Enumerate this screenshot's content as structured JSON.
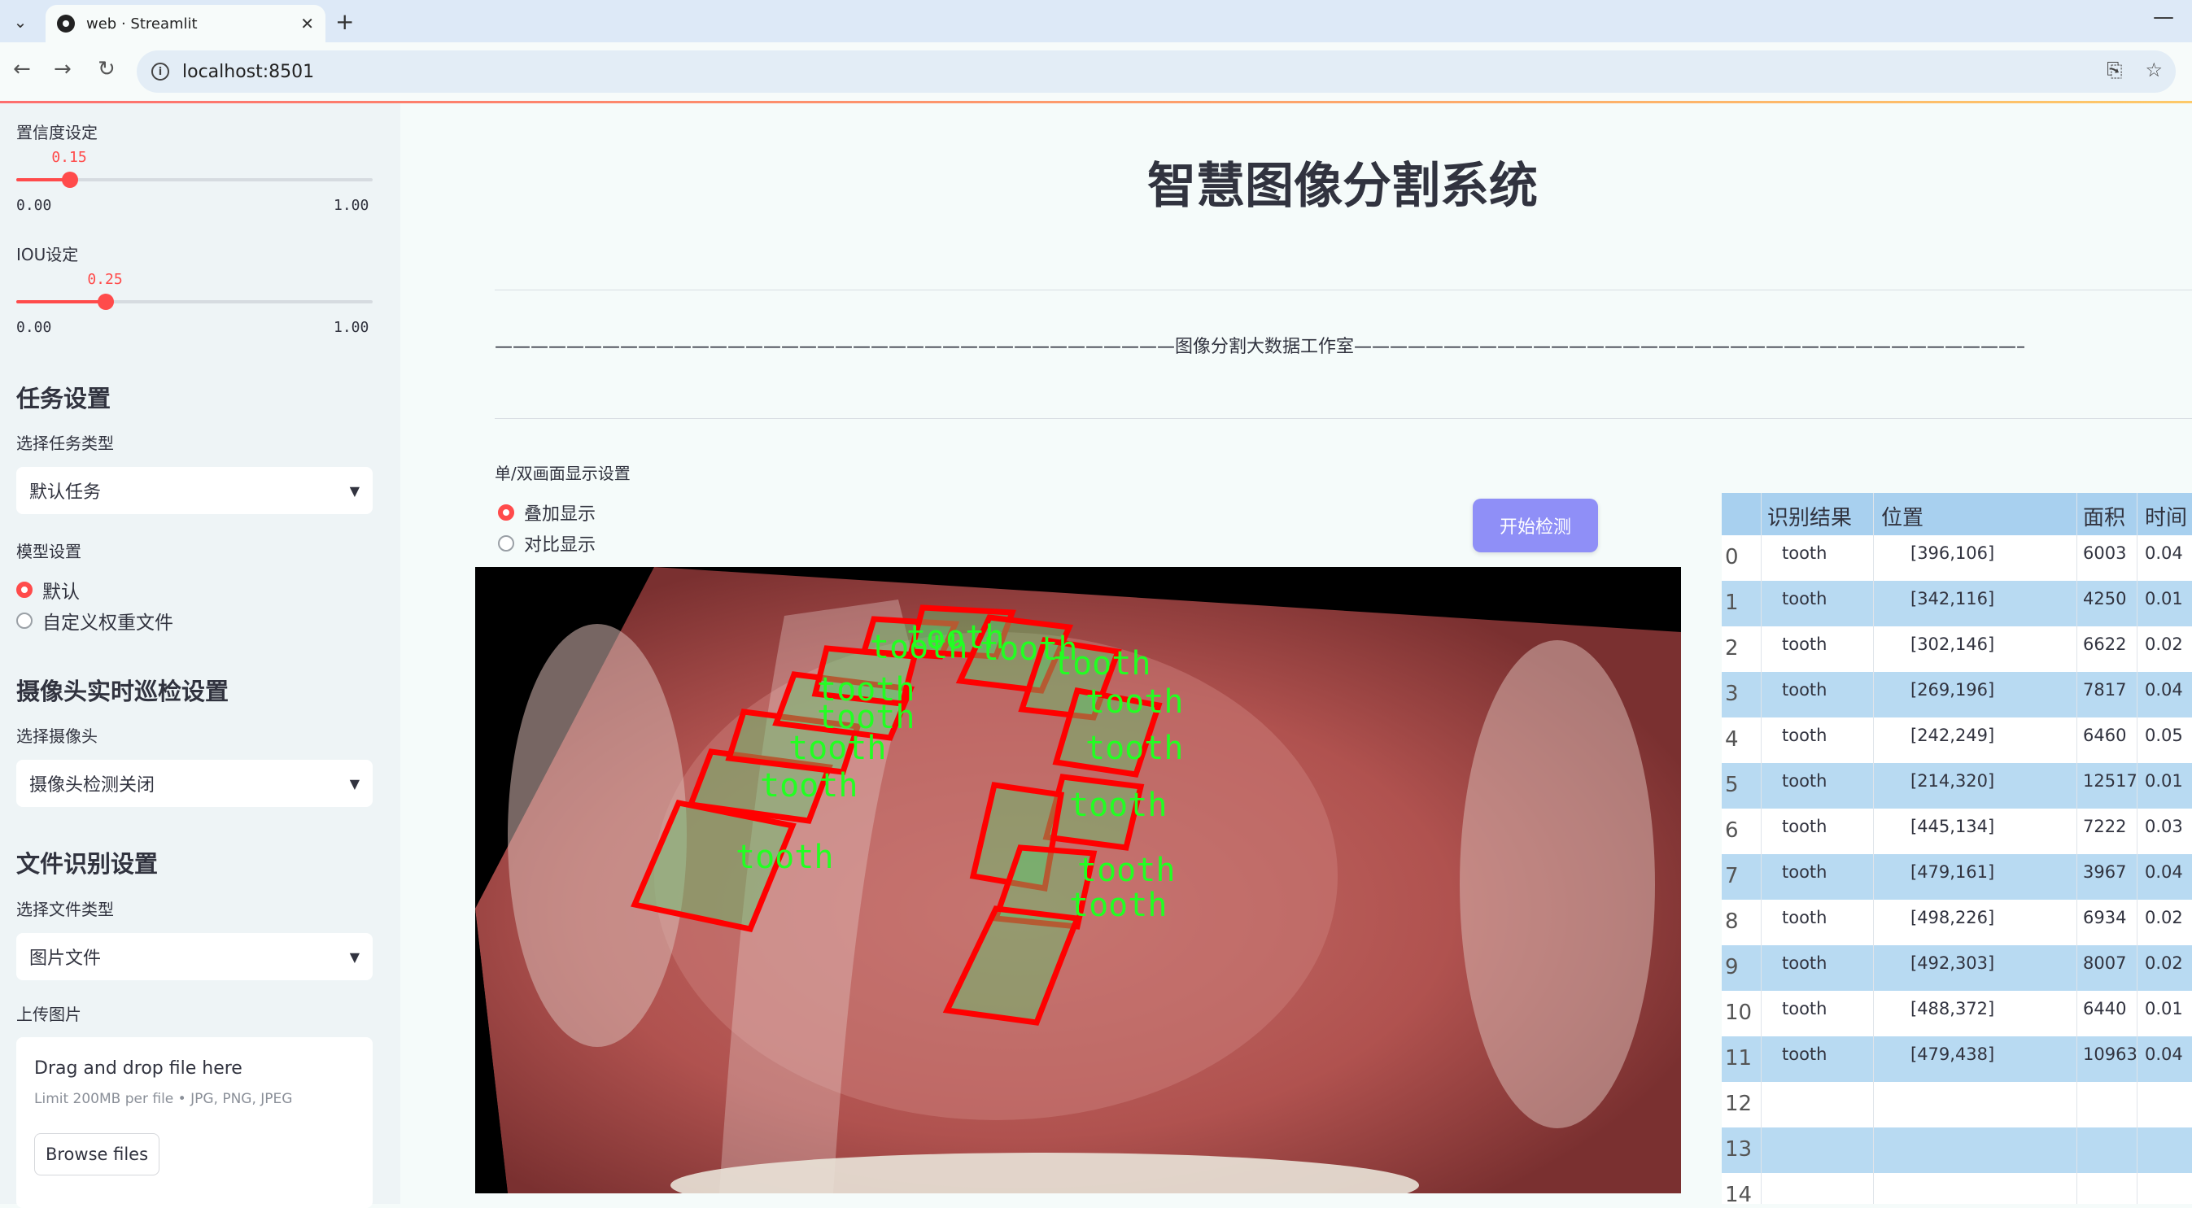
{
  "browser": {
    "tab_title": "web · Streamlit",
    "url": "localhost:8501"
  },
  "sidebar": {
    "confidence": {
      "label": "置信度设定",
      "value": "0.15",
      "value_num": 0.15,
      "min": "0.00",
      "max": "1.00"
    },
    "iou": {
      "label": "IOU设定",
      "value": "0.25",
      "value_num": 0.25,
      "min": "0.00",
      "max": "1.00"
    },
    "task_heading": "任务设置",
    "task_type_label": "选择任务类型",
    "task_type_value": "默认任务",
    "model_label": "模型设置",
    "model_options": [
      "默认",
      "自定义权重文件"
    ],
    "camera_heading": "摄像头实时巡检设置",
    "camera_label": "选择摄像头",
    "camera_value": "摄像头检测关闭",
    "file_heading": "文件识别设置",
    "file_type_label": "选择文件类型",
    "file_type_value": "图片文件",
    "upload_label": "上传图片",
    "upload_title": "Drag and drop file here",
    "upload_sub": "Limit 200MB per file • JPG, PNG, JPEG",
    "browse_label": "Browse files"
  },
  "main": {
    "title": "智慧图像分割系统",
    "studio_line": "——————————————————————————————————————图像分割大数据工作室——————————————————————————————————————————",
    "display_label": "单/双画面显示设置",
    "display_options": [
      "叠加显示",
      "对比显示"
    ],
    "start_button": "开始检测",
    "overlay_label": "tooth"
  },
  "colors": {
    "accent": "#ff4b4b",
    "button": "#8f8ff7",
    "table_header": "#a8d0ef",
    "table_alt": "#b8daf2",
    "box": "#ff0000",
    "label": "#22ff22"
  },
  "table": {
    "headers": [
      "",
      "识别结果",
      "位置",
      "面积",
      "时间"
    ],
    "rows": [
      {
        "idx": "0",
        "result": "tooth",
        "pos": "[396,106]",
        "area": "6003",
        "time": "0.04"
      },
      {
        "idx": "1",
        "result": "tooth",
        "pos": "[342,116]",
        "area": "4250",
        "time": "0.01"
      },
      {
        "idx": "2",
        "result": "tooth",
        "pos": "[302,146]",
        "area": "6622",
        "time": "0.02"
      },
      {
        "idx": "3",
        "result": "tooth",
        "pos": "[269,196]",
        "area": "7817",
        "time": "0.04"
      },
      {
        "idx": "4",
        "result": "tooth",
        "pos": "[242,249]",
        "area": "6460",
        "time": "0.05"
      },
      {
        "idx": "5",
        "result": "tooth",
        "pos": "[214,320]",
        "area": "12517",
        "time": "0.01"
      },
      {
        "idx": "6",
        "result": "tooth",
        "pos": "[445,134]",
        "area": "7222",
        "time": "0.03"
      },
      {
        "idx": "7",
        "result": "tooth",
        "pos": "[479,161]",
        "area": "3967",
        "time": "0.04"
      },
      {
        "idx": "8",
        "result": "tooth",
        "pos": "[498,226]",
        "area": "6934",
        "time": "0.02"
      },
      {
        "idx": "9",
        "result": "tooth",
        "pos": "[492,303]",
        "area": "8007",
        "time": "0.02"
      },
      {
        "idx": "10",
        "result": "tooth",
        "pos": "[488,372]",
        "area": "6440",
        "time": "0.01"
      },
      {
        "idx": "11",
        "result": "tooth",
        "pos": "[479,438]",
        "area": "10963",
        "time": "0.04"
      },
      {
        "idx": "12",
        "result": "",
        "pos": "",
        "area": "",
        "time": ""
      },
      {
        "idx": "13",
        "result": "",
        "pos": "",
        "area": "",
        "time": ""
      },
      {
        "idx": "14",
        "result": "",
        "pos": "",
        "area": "",
        "time": ""
      }
    ]
  }
}
